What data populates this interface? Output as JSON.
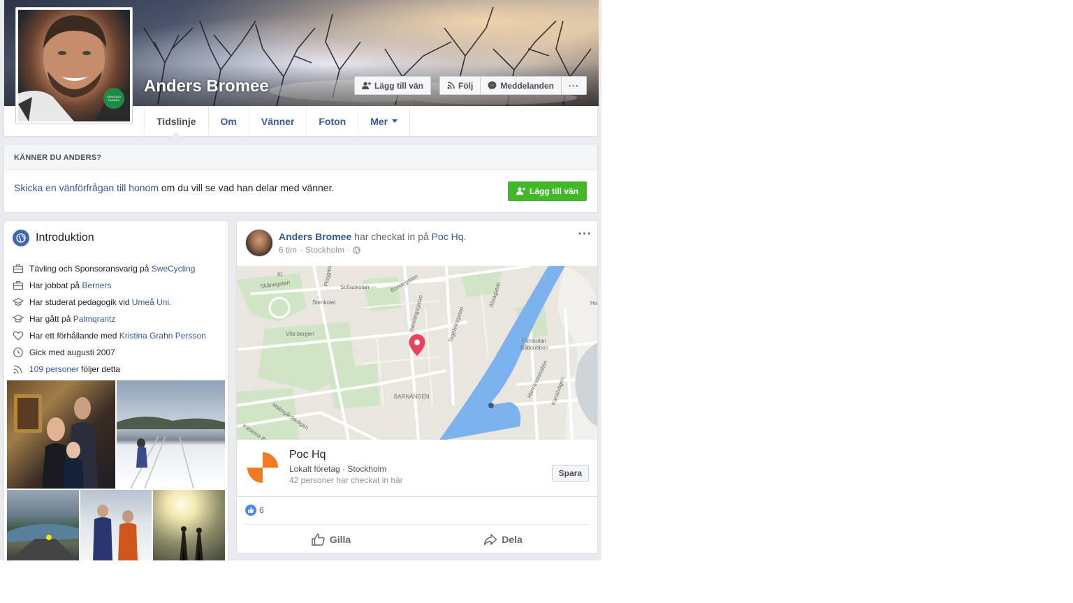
{
  "profile": {
    "name": "Anders Bromee",
    "badge_text": "SÅNGGUR PARKEN"
  },
  "cover_actions": {
    "add_friend": "Lägg till vän",
    "follow": "Följ",
    "message": "Meddelanden",
    "more": "···"
  },
  "tabs": [
    {
      "label": "Tidslinje",
      "active": true
    },
    {
      "label": "Om"
    },
    {
      "label": "Vänner"
    },
    {
      "label": "Foton"
    },
    {
      "label": "Mer"
    }
  ],
  "know": {
    "header": "KÄNNER DU ANDERS?",
    "link_text": "Skicka en vänförfrågan till honom",
    "rest_text": " om du vill se vad han delar med vänner.",
    "button": "Lägg till vän"
  },
  "intro": {
    "title": "Introduktion",
    "items": [
      {
        "icon": "briefcase-icon",
        "prefix": "Tävling och Sponsoransvarig på ",
        "link": "SweCycling",
        "suffix": ""
      },
      {
        "icon": "briefcase-icon",
        "prefix": "Har jobbat på ",
        "link": "Berners",
        "suffix": ""
      },
      {
        "icon": "graduation-cap-icon",
        "prefix": "Har studerat pedagogik vid ",
        "link": "Umeå Uni.",
        "suffix": ""
      },
      {
        "icon": "graduation-cap-icon",
        "prefix": "Har gått på ",
        "link": "Palmqrantz",
        "suffix": ""
      },
      {
        "icon": "heart-icon",
        "prefix": "Har ett förhållande med ",
        "link": "Kristina Grahn Persson",
        "suffix": ""
      },
      {
        "icon": "clock-icon",
        "prefix": "Gick med augusti 2007",
        "link": "",
        "suffix": ""
      },
      {
        "icon": "rss-icon",
        "prefix": "",
        "link": "109 personer",
        "suffix": " följer detta"
      }
    ]
  },
  "post": {
    "author": "Anders Bromee",
    "action": " har checkat in på ",
    "place_link": "Poc Hq",
    "period": ".",
    "time": "6 tim",
    "location": "Stockholm",
    "dots": "···",
    "place": {
      "name": "Poc Hq",
      "type": "Lokalt företag · Stockholm",
      "checkins": "42 personer har checkat in här",
      "save": "Spara"
    },
    "likes": "6",
    "like_label": "Gilla",
    "share_label": "Dela"
  },
  "map": {
    "labels": [
      "Skånegatan",
      "Bondegatan",
      "Sofiaskolan",
      "Stenkolet",
      "Vita bergen",
      "Barnängsgatan",
      "Tegelviksgatan",
      "Alstagatan",
      "Förskolan Båtklubben",
      "Henriksdalsallén",
      "Kanalvägen",
      "Malmgårdsvägen",
      "Katarina Bangata",
      "BARNÄNGEN",
      "Ploggatan",
      "Kl",
      "He"
    ]
  },
  "colors": {
    "accent": "#4267b2",
    "link": "#365899",
    "green": "#42b72a",
    "water": "#7cb2ee",
    "pin": "#e8435a",
    "brand_orange": "#f27b21"
  }
}
